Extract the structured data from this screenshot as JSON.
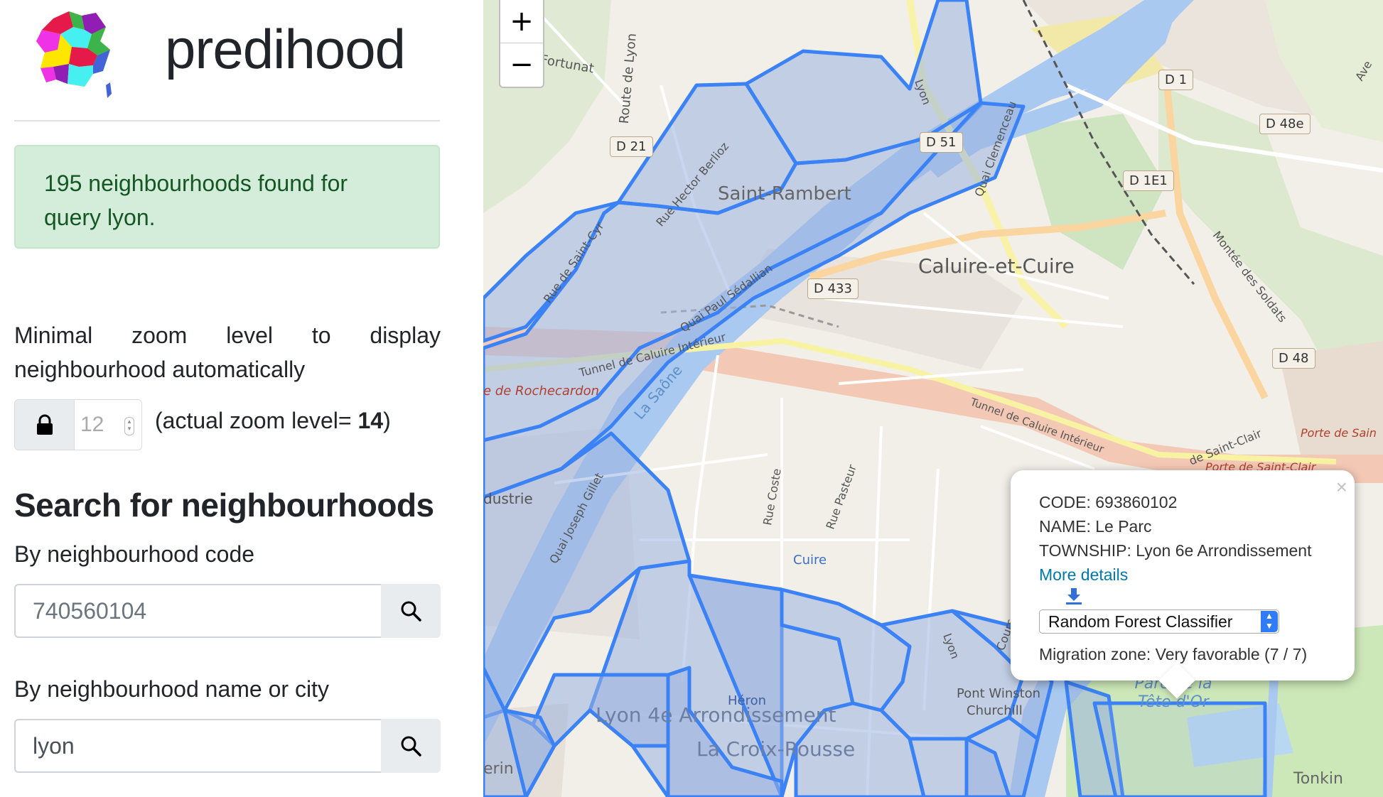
{
  "brand": {
    "name": "predihood"
  },
  "alert": {
    "text": "195 neighbourhoods found for query lyon."
  },
  "zoom_setting": {
    "label_line1": "Minimal zoom level to display",
    "label_line2": "neighbourhood automatically",
    "min_zoom_value": "12",
    "actual_zoom_prefix": "(actual zoom level= ",
    "actual_zoom_value": "14",
    "actual_zoom_suffix": ")"
  },
  "search": {
    "heading": "Search for neighbourhoods",
    "by_code_label": "By neighbourhood code",
    "code_placeholder": "740560104",
    "by_name_label": "By neighbourhood name or city",
    "name_value": "lyon"
  },
  "map": {
    "zoom_in_label": "+",
    "zoom_out_label": "−",
    "labels": {
      "fortunat": "Fortunat",
      "route_de_lyon": "Route de Lyon",
      "saint_rambert": "Saint-Rambert",
      "rue_hector_berlioz": "Rue Hector Berlioz",
      "rue_de_saint_cyr": "Rue de Saint-Cyr",
      "lyon_top": "Lyon",
      "quai_clemenceau": "Quai Clemenceau",
      "caluire": "Caluire-et-Cuire",
      "quai_paul": "Quai Paul Sédallian",
      "tunnel_caluire": "Tunnel de Caluire Intérieur",
      "tunnel_caluire2": "Tunnel de Caluire Intérieur",
      "rochecardon": "e de Rochecardon",
      "la_saone": "La Saône",
      "industrie": "dustrie",
      "quai_gillet": "Quai Joseph Gillet",
      "rue_coste": "Rue Coste",
      "rue_pasteur": "Rue Pasteur",
      "cuire": "Cuire",
      "montee_soldats": "Montée des Soldats",
      "lyon4": "Lyon 4e Arrondissement",
      "heron": "Héron",
      "croix_rousse": "La Croix-Rousse",
      "pont_winston": "Pont Winston",
      "churchill": "Churchill",
      "parc_tete": "Parc de la Tête d'Or",
      "tonkin": "Tonkin",
      "erin": "erin",
      "porte_saint": "Porte de Sain",
      "porte_saint_clair": "Porte de Saint-Clair",
      "saint_clair": "de Saint-Clair",
      "av": "Ave",
      "lyon_right": "Lyon",
      "cours": "Cours"
    },
    "road_shields": [
      "D 21",
      "D 51",
      "D 433",
      "D 1",
      "D 48e",
      "D 1E1",
      "D 48"
    ]
  },
  "popup": {
    "code_line": "CODE: 693860102",
    "name_line": "NAME: Le Parc",
    "township_line": "TOWNSHIP: Lyon 6e Arrondissement",
    "more_details": "More details",
    "classifier_selected": "Random Forest Classifier",
    "migration_line": "Migration zone: Very favorable (7 / 7)",
    "close_label": "×"
  },
  "colors": {
    "polygon_stroke": "#3b82f6",
    "polygon_fill": "#9bb3e0",
    "river": "#a9c9f0",
    "alert_bg": "#d4edda",
    "alert_text": "#155724"
  }
}
